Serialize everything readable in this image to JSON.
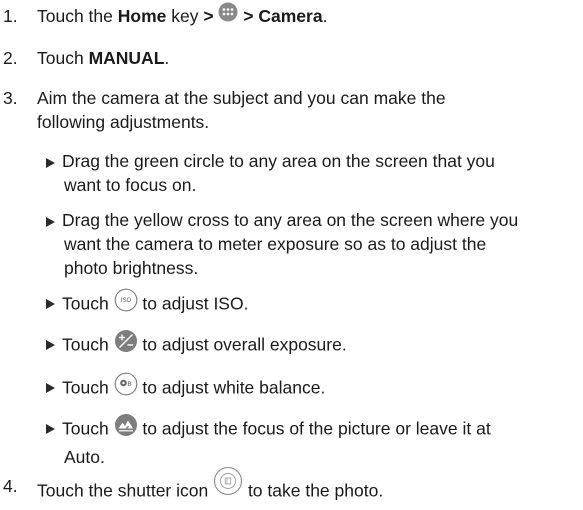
{
  "steps": [
    {
      "number": "1.",
      "parts": {
        "a": "Touch the ",
        "b": "Home",
        "c": " key",
        "d": " > ",
        "e": " > Camera",
        "f": "."
      },
      "icon": "apps-icon"
    },
    {
      "number": "2.",
      "parts": {
        "a": "Touch ",
        "b": "MANUAL",
        "c": "."
      }
    },
    {
      "number": "3.",
      "lines": [
        "Aim the camera at the subject and you can make the",
        "following adjustments."
      ]
    },
    {
      "number": "4.",
      "parts": {
        "a": "Touch the shutter icon ",
        "b": " to take the photo."
      },
      "icon": "shutter-icon"
    }
  ],
  "bullets": [
    {
      "lines": [
        "Drag the green circle to any area on the screen that you",
        "want to focus on."
      ]
    },
    {
      "lines": [
        "Drag the yellow cross to any area on the screen where you",
        "want the camera to meter exposure so as to adjust the",
        "photo brightness."
      ]
    },
    {
      "before": "Touch ",
      "after": " to adjust ISO.",
      "icon": "iso-icon",
      "icon_text": "ISO"
    },
    {
      "before": "Touch ",
      "after": " to adjust overall exposure.",
      "icon": "exposure-icon"
    },
    {
      "before": "Touch ",
      "after": " to adjust white balance.",
      "icon": "white-balance-icon",
      "icon_text": "B"
    },
    {
      "before": "Touch ",
      "after": " to adjust the focus of the picture or leave it at",
      "line2": "Auto.",
      "icon": "focus-icon"
    }
  ]
}
